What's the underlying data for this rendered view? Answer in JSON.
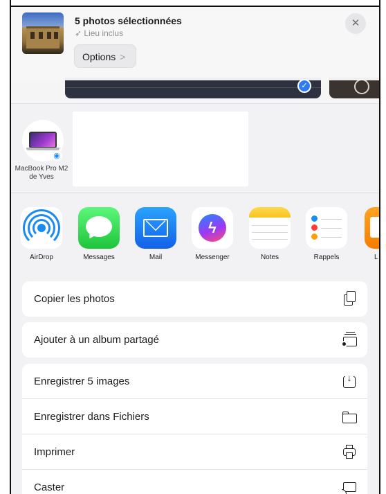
{
  "header": {
    "title": "5 photos sélectionnées",
    "subtitle": "Lieu inclus",
    "options_label": "Options",
    "options_chevron": ">",
    "close_glyph": "✕"
  },
  "airdrop_device": {
    "name": "MacBook Pro M2 de Yves",
    "icon": "laptop-icon",
    "badge_icon": "airdrop-badge-icon"
  },
  "apps": [
    {
      "label": "AirDrop",
      "icon": "airdrop-icon"
    },
    {
      "label": "Messages",
      "icon": "messages-icon"
    },
    {
      "label": "Mail",
      "icon": "mail-icon"
    },
    {
      "label": "Messenger",
      "icon": "messenger-icon"
    },
    {
      "label": "Notes",
      "icon": "notes-icon"
    },
    {
      "label": "Rappels",
      "icon": "reminders-icon"
    },
    {
      "label": "L",
      "icon": "partial-app-icon"
    }
  ],
  "actions_group1": [
    {
      "label": "Copier les photos",
      "icon": "copy-icon"
    }
  ],
  "actions_group2": [
    {
      "label": "Ajouter à un album partagé",
      "icon": "shared-album-icon"
    }
  ],
  "actions_group3": [
    {
      "label": "Enregistrer 5 images",
      "icon": "save-images-icon"
    },
    {
      "label": "Enregistrer dans Fichiers",
      "icon": "folder-icon"
    },
    {
      "label": "Imprimer",
      "icon": "print-icon"
    },
    {
      "label": "Caster",
      "icon": "cast-icon"
    }
  ],
  "colors": {
    "accent_blue": "#1a8cf0",
    "messages_green": "#1fc43b",
    "sheet_background": "#f2f2f4"
  }
}
